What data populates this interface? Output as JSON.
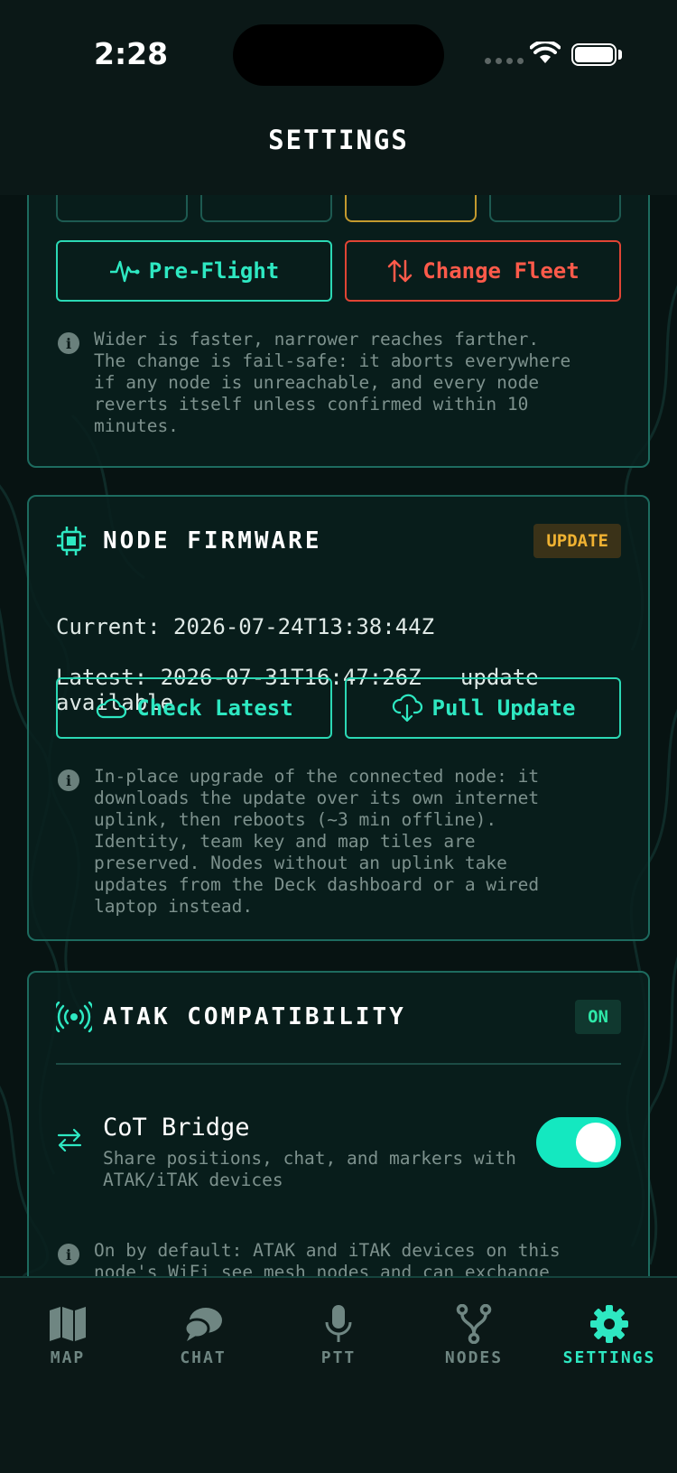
{
  "status_bar": {
    "time": "2:28"
  },
  "header": {
    "title": "SETTINGS"
  },
  "radio_card": {
    "preflight_label": "Pre-Flight",
    "change_fleet_label": "Change Fleet",
    "info": "Wider is faster, narrower reaches farther.\nThe change is fail-safe: it aborts everywhere\nif any node is unreachable, and every node\nreverts itself unless confirmed within 10\nminutes.",
    "selected_segment_index": 2,
    "colors": {
      "accent": "#2ee8c2",
      "danger": "#ff5a4a",
      "selected": "#c39a2e"
    }
  },
  "firmware_card": {
    "title": "NODE FIRMWARE",
    "badge": "UPDATE",
    "current_line": "Current: 2026-07-24T13:38:44Z",
    "latest_line": "Latest: 2026-07-31T16:47:26Z — update\navailable",
    "check_label": "Check Latest",
    "pull_label": "Pull Update",
    "info": "In-place upgrade of the connected node: it\ndownloads the update over its own internet\nuplink, then reboots (~3 min offline).\nIdentity, team key and map tiles are\npreserved. Nodes without an uplink take\nupdates from the Deck dashboard or a wired\nlaptop instead."
  },
  "atak_card": {
    "title": "ATAK COMPATIBILITY",
    "badge": "ON",
    "toggle_title": "CoT Bridge",
    "toggle_sub": "Share positions, chat, and markers with\nATAK/iTAK devices",
    "toggle_on": true,
    "info": "On by default: ATAK and iTAK devices on this\nnode's WiFi see mesh nodes and can exchange"
  },
  "tabs": [
    {
      "label": "MAP",
      "icon": "map-icon",
      "active": false
    },
    {
      "label": "CHAT",
      "icon": "chat-icon",
      "active": false
    },
    {
      "label": "PTT",
      "icon": "mic-icon",
      "active": false
    },
    {
      "label": "NODES",
      "icon": "nodes-icon",
      "active": false
    },
    {
      "label": "SETTINGS",
      "icon": "gear-icon",
      "active": true
    }
  ]
}
